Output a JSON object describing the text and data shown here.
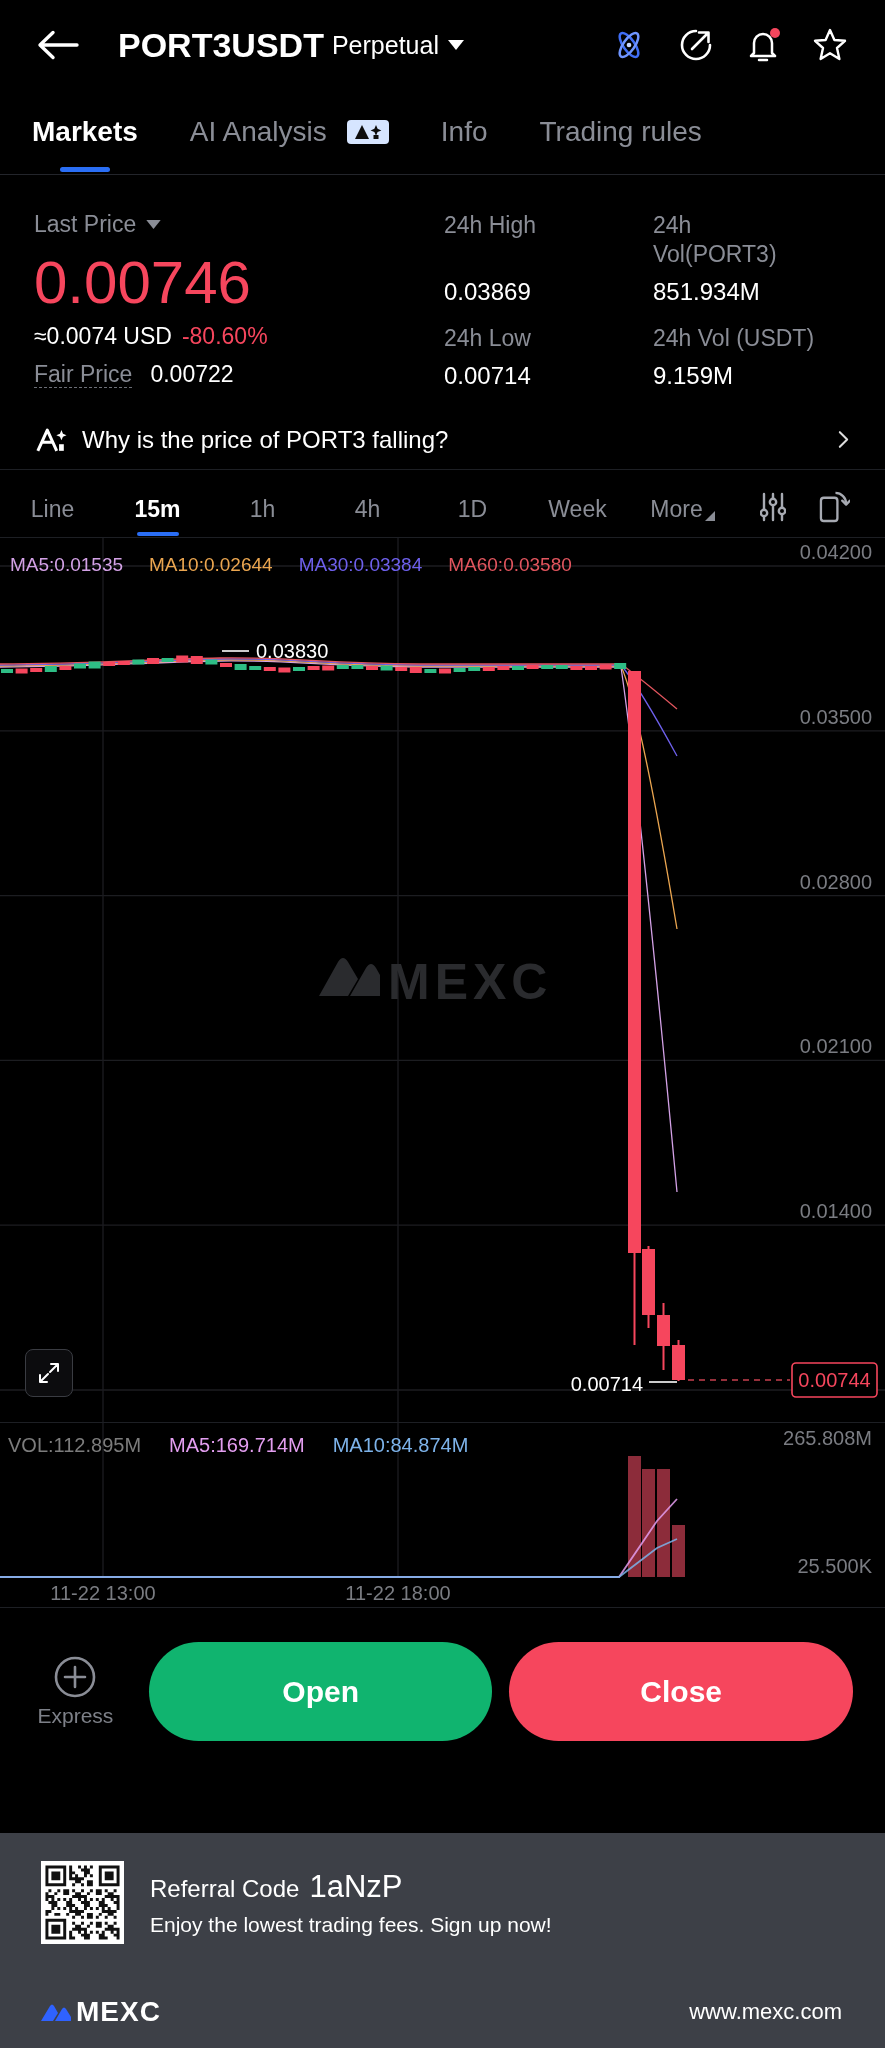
{
  "header": {
    "title": "PORT3USDT",
    "contract_type": "Perpetual",
    "bell_unread": true,
    "favorite": false
  },
  "tabs": [
    {
      "label": "Markets",
      "selected": true,
      "ai_badge": false
    },
    {
      "label": "AI Analysis",
      "selected": false,
      "ai_badge": true
    },
    {
      "label": "Info",
      "selected": false,
      "ai_badge": false
    },
    {
      "label": "Trading rules",
      "selected": false,
      "ai_badge": false
    }
  ],
  "price": {
    "label": "Last Price",
    "value": "0.00746",
    "falling": true,
    "usd_value": "≈0.0074 USD",
    "change": "-80.60%",
    "fair_price_label": "Fair Price",
    "fair_price": "0.00722"
  },
  "stats": [
    {
      "label": "24h High",
      "value": "0.03869"
    },
    {
      "label": "24h Vol(PORT3)",
      "value": "851.934M"
    },
    {
      "label": "24h Low",
      "value": "0.00714"
    },
    {
      "label": "24h Vol (USDT)",
      "value": "9.159M"
    }
  ],
  "ai_prompt": {
    "text": "Why is the price of PORT3 falling?"
  },
  "intervals": [
    {
      "label": "Line",
      "selected": false,
      "kind": "option"
    },
    {
      "label": "15m",
      "selected": true,
      "kind": "option"
    },
    {
      "label": "1h",
      "selected": false,
      "kind": "option"
    },
    {
      "label": "4h",
      "selected": false,
      "kind": "option"
    },
    {
      "label": "1D",
      "selected": false,
      "kind": "option"
    },
    {
      "label": "Week",
      "selected": false,
      "kind": "option"
    },
    {
      "label": "More",
      "selected": false,
      "kind": "menu"
    }
  ],
  "chart": {
    "ma_legend": [
      {
        "label": "MA5:0.01535",
        "color": "#d3a1e6"
      },
      {
        "label": "MA10:0.02644",
        "color": "#eba650"
      },
      {
        "label": "MA30:0.03384",
        "color": "#6e60ec"
      },
      {
        "label": "MA60:0.03580",
        "color": "#e2555e"
      }
    ],
    "price_axis": [
      "0.04200",
      "0.03500",
      "0.02800",
      "0.02100",
      "0.01400"
    ],
    "high_marker": "0.03830",
    "low_marker": "0.00714",
    "last_price": "0.00744",
    "watermark": "MEXC"
  },
  "volume": {
    "legend": [
      {
        "label": "VOL:112.895M",
        "color": "#7c7c7c"
      },
      {
        "label": "MA5:169.714M",
        "color": "#e39ef0"
      },
      {
        "label": "MA10:84.874M",
        "color": "#7db3ea"
      }
    ],
    "axis_max": "265.808M",
    "axis_min": "25.500K"
  },
  "time_axis": [
    "11-22 13:00",
    "11-22 18:00"
  ],
  "actions": {
    "express": "Express",
    "buttons": [
      {
        "label": "Open",
        "kind": "open"
      },
      {
        "label": "Close",
        "kind": "close"
      }
    ]
  },
  "referral": {
    "label": "Referral Code",
    "code": "1aNzP",
    "tagline": "Enjoy the lowest trading fees. Sign up now!",
    "brand": "MEXC",
    "url": "www.mexc.com"
  }
}
